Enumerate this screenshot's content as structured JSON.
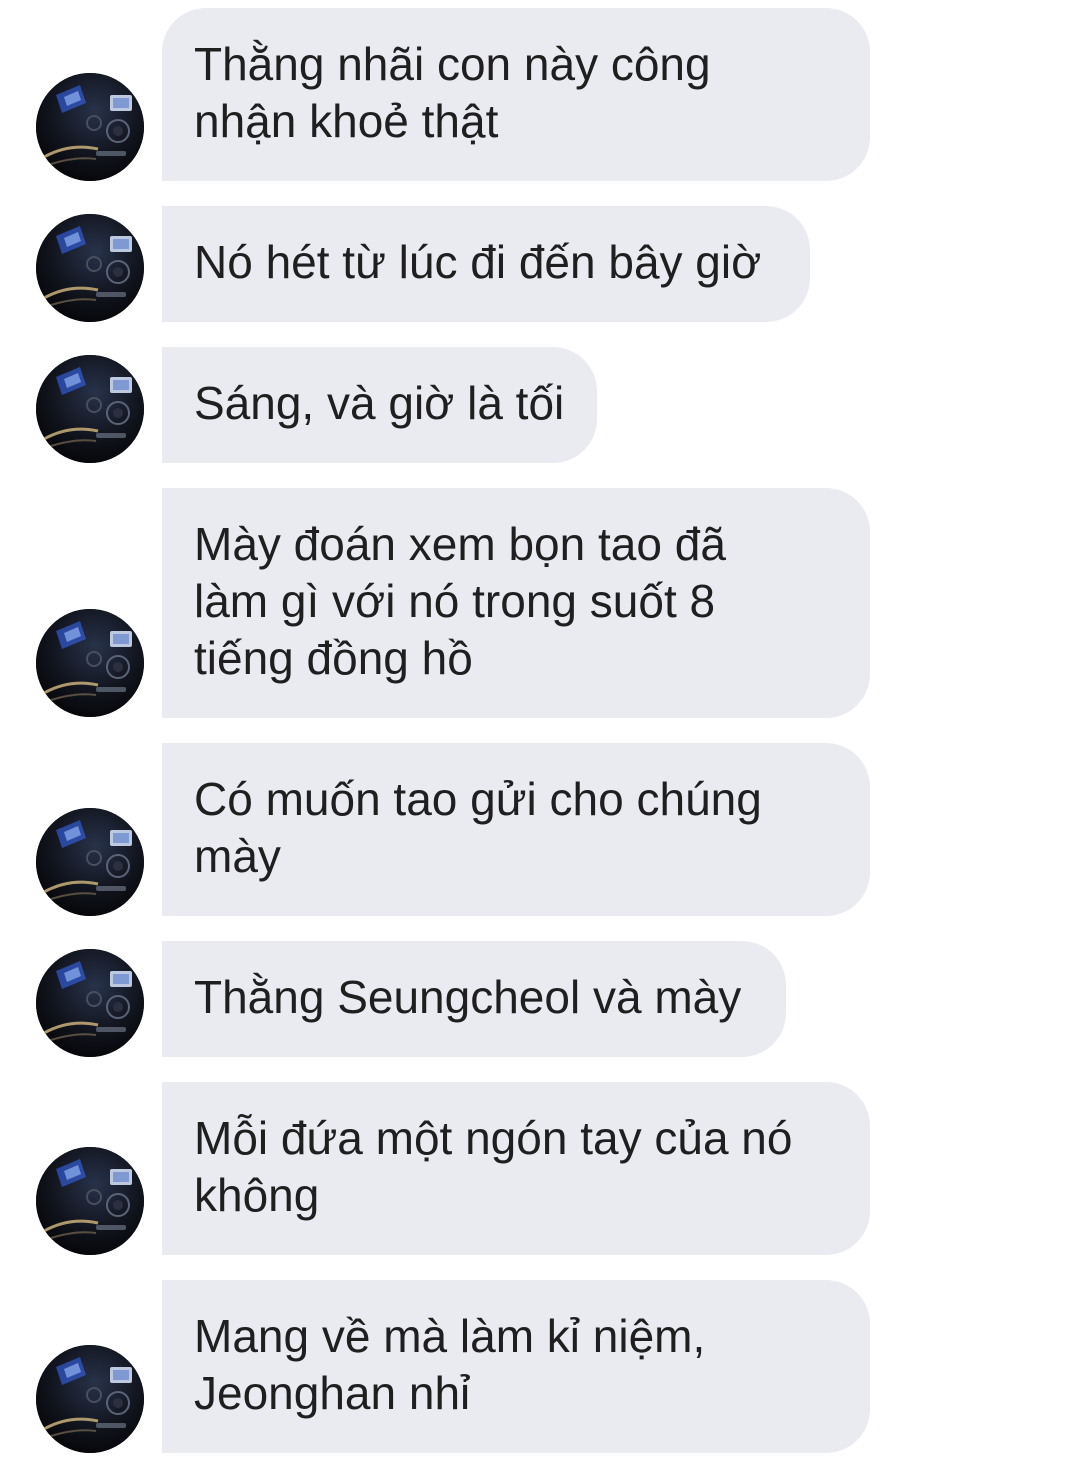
{
  "conversation": {
    "messages": [
      {
        "text": "Thằng nhãi con này công\nnhận khoẻ thật"
      },
      {
        "text": "Nó hét từ lúc đi đến bây giờ"
      },
      {
        "text": "Sáng, và giờ là tối"
      },
      {
        "text": "Mày đoán xem bọn tao đã\nlàm gì với nó trong suốt 8\ntiếng đồng hồ"
      },
      {
        "text": "Có muốn tao gửi cho chúng\nmày"
      },
      {
        "text": "Thằng Seungcheol và mày"
      },
      {
        "text": "Mỗi đứa một ngón tay của nó\nkhông"
      },
      {
        "text": "Mang về mà làm kỉ niệm,\nJeonghan nhỉ"
      }
    ],
    "avatar": {
      "icon": "car-dashboard-avatar-icon"
    },
    "colors": {
      "bubble_background": "#e9ebf0",
      "text": "#1f1f1f",
      "page_background": "#ffffff"
    }
  }
}
